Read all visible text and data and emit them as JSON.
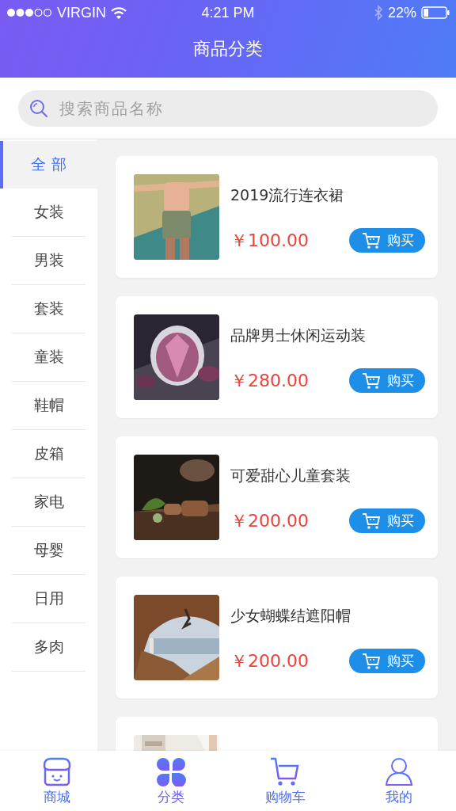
{
  "status_bar": {
    "carrier": "VIRGIN",
    "time": "4:21 PM",
    "battery": "22%"
  },
  "header": {
    "title": "商品分类"
  },
  "search": {
    "placeholder": "搜索商品名称"
  },
  "categories": [
    {
      "label": "全 部",
      "selected": true
    },
    {
      "label": "女装",
      "selected": false
    },
    {
      "label": "男装",
      "selected": false
    },
    {
      "label": "套装",
      "selected": false
    },
    {
      "label": "童装",
      "selected": false
    },
    {
      "label": "鞋帽",
      "selected": false
    },
    {
      "label": "皮箱",
      "selected": false
    },
    {
      "label": "家电",
      "selected": false
    },
    {
      "label": "母婴",
      "selected": false
    },
    {
      "label": "日用",
      "selected": false
    },
    {
      "label": "多肉",
      "selected": false
    }
  ],
  "products": [
    {
      "image": {
        "kind": "picture"
      },
      "name": "2019流行连衣裙",
      "price": "￥100.00",
      "button": "购买"
    },
    {
      "image": {
        "kind": "picture"
      },
      "name": "品牌男士休闲运动装",
      "price": "￥280.00",
      "button": "购买"
    },
    {
      "image": {
        "kind": "picture"
      },
      "name": "可爱甜心儿童套装",
      "price": "￥200.00",
      "button": "购买"
    },
    {
      "image": {
        "kind": "picture"
      },
      "name": "少女蝴蝶结遮阳帽",
      "price": "￥200.00",
      "button": "购买"
    },
    {
      "image": {
        "kind": "picture"
      }
    }
  ],
  "tab_bar": [
    {
      "kind": "shop",
      "label": "商城",
      "selected": false
    },
    {
      "kind": "category",
      "label": "分类",
      "selected": true
    },
    {
      "kind": "cart",
      "label": "购物车",
      "selected": false
    },
    {
      "kind": "profile",
      "label": "我的",
      "selected": false
    }
  ]
}
